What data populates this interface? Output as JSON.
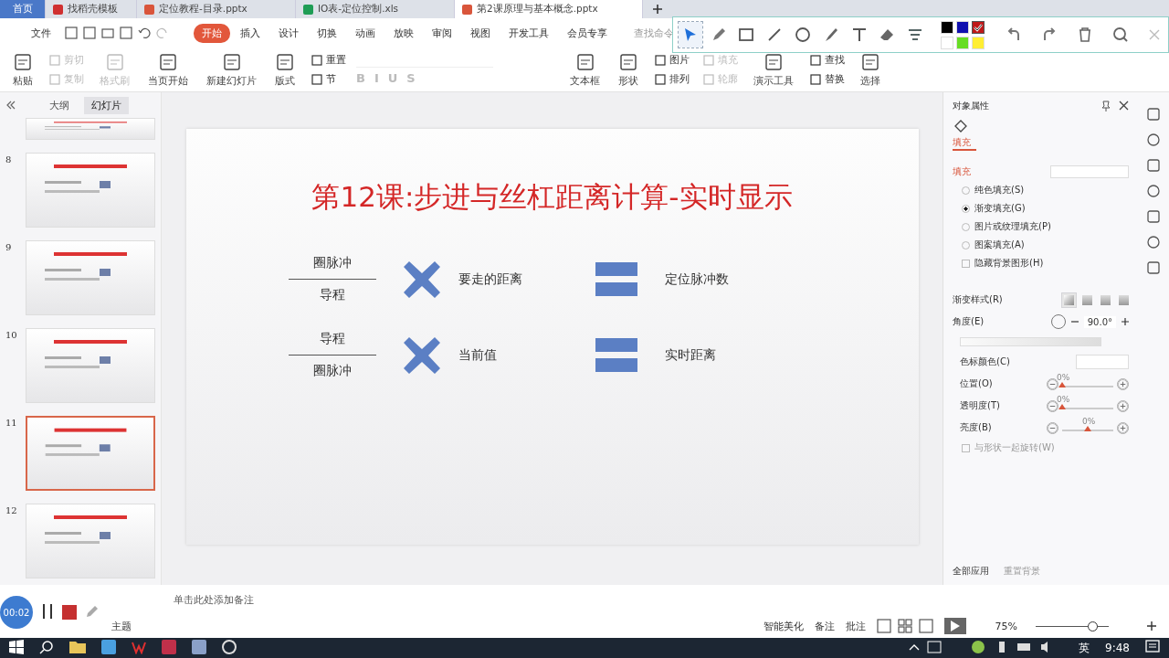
{
  "tabs": [
    {
      "label": "首页",
      "kind": "home",
      "selected": false
    },
    {
      "label": "找稻壳模板",
      "kind": "wps",
      "selected": false
    },
    {
      "label": "定位教程-目录.pptx",
      "kind": "ppt",
      "selected": false
    },
    {
      "label": "IO表-定位控制.xls",
      "kind": "xls",
      "selected": false
    },
    {
      "label": "第2课原理与基本概念.pptx",
      "kind": "ppt",
      "selected": true
    }
  ],
  "menu": {
    "file": "文件",
    "items": [
      {
        "label": "开始",
        "selected": true
      },
      {
        "label": "插入",
        "selected": false
      },
      {
        "label": "设计",
        "selected": false
      },
      {
        "label": "切换",
        "selected": false
      },
      {
        "label": "动画",
        "selected": false
      },
      {
        "label": "放映",
        "selected": false
      },
      {
        "label": "审阅",
        "selected": false
      },
      {
        "label": "视图",
        "selected": false
      },
      {
        "label": "开发工具",
        "selected": false
      },
      {
        "label": "会员专享",
        "selected": false
      }
    ],
    "search": "查找命令"
  },
  "ribbon": [
    {
      "kind": "big",
      "label": "粘贴",
      "disabled": false
    },
    {
      "kind": "pair",
      "items": [
        {
          "label": "剪切",
          "disabled": true
        },
        {
          "label": "复制",
          "disabled": true
        }
      ]
    },
    {
      "kind": "big",
      "label": "格式刷",
      "disabled": true
    },
    {
      "kind": "big",
      "label": "当页开始",
      "disabled": false
    },
    {
      "kind": "big",
      "label": "新建幻灯片",
      "disabled": false
    },
    {
      "kind": "big",
      "label": "版式",
      "disabled": false
    },
    {
      "kind": "pair",
      "items": [
        {
          "label": "重置",
          "disabled": false
        },
        {
          "label": "节",
          "disabled": false
        }
      ]
    },
    {
      "kind": "format",
      "buttons": [
        "B",
        "I",
        "U",
        "S"
      ]
    },
    {
      "kind": "big",
      "label": "文本框",
      "disabled": false
    },
    {
      "kind": "big",
      "label": "形状",
      "disabled": false
    },
    {
      "kind": "pair",
      "items": [
        {
          "label": "图片",
          "disabled": false
        },
        {
          "label": "排列",
          "disabled": false
        }
      ]
    },
    {
      "kind": "pair",
      "items": [
        {
          "label": "填充",
          "disabled": true
        },
        {
          "label": "轮廓",
          "disabled": true
        }
      ]
    },
    {
      "kind": "big",
      "label": "演示工具",
      "disabled": false
    },
    {
      "kind": "pair",
      "items": [
        {
          "label": "查找",
          "disabled": false
        },
        {
          "label": "替换",
          "disabled": false
        }
      ]
    },
    {
      "kind": "big",
      "label": "选择",
      "disabled": false
    }
  ],
  "annotation_toolbar": {
    "tools": [
      {
        "selected": true
      },
      {
        "selected": false
      },
      {
        "selected": false
      },
      {
        "selected": false
      },
      {
        "selected": false
      },
      {
        "selected": false
      },
      {
        "selected": false
      },
      {
        "selected": false
      },
      {
        "selected": false
      }
    ],
    "colors": [
      {
        "color": "#000000",
        "selected": false
      },
      {
        "color": "#1010b0",
        "selected": false
      },
      {
        "color": "#c01818",
        "selected": true
      },
      {
        "color": "#ffffff",
        "selected": false
      },
      {
        "color": "#66dd22",
        "selected": false
      },
      {
        "color": "#ffee33",
        "selected": false
      }
    ]
  },
  "slide_panel": {
    "tabs": [
      {
        "label": "大纲",
        "selected": false
      },
      {
        "label": "幻灯片",
        "selected": true
      }
    ],
    "slides": [
      {
        "selected": false
      },
      {
        "number": "8",
        "selected": false
      },
      {
        "number": "9",
        "selected": false
      },
      {
        "number": "10",
        "selected": false
      },
      {
        "number": "11",
        "selected": true
      },
      {
        "number": "12",
        "selected": false
      }
    ]
  },
  "slide": {
    "title": "第12课:步进与丝杠距离计算-实时显示",
    "rows": [
      {
        "numerator": "圈脉冲",
        "denominator": "导程",
        "operand": "要走的距离",
        "result": "定位脉冲数"
      },
      {
        "numerator": "导程",
        "denominator": "圈脉冲",
        "operand": "当前值",
        "result": "实时距离"
      }
    ]
  },
  "notes": "单击此处添加备注",
  "properties": {
    "title": "对象属性",
    "tab": {
      "label": "填充",
      "selected": true
    },
    "section": "填充",
    "options": [
      {
        "kind": "radio",
        "label": "纯色填充(S)",
        "selected": false
      },
      {
        "kind": "radio",
        "label": "渐变填充(G)",
        "selected": true
      },
      {
        "kind": "radio",
        "label": "图片或纹理填充(P)",
        "selected": false
      },
      {
        "kind": "radio",
        "label": "图案填充(A)",
        "selected": false
      },
      {
        "kind": "checkbox",
        "label": "隐藏背景图形(H)",
        "selected": false
      }
    ],
    "gradient_style": {
      "label": "渐变样式(R)",
      "styles": [
        {
          "selected": true
        },
        {
          "selected": false
        },
        {
          "selected": false
        },
        {
          "selected": false
        }
      ]
    },
    "angle": {
      "label": "角度(E)",
      "value": "90.0°"
    },
    "stop_color": "色标颜色(C)",
    "sliders": [
      {
        "label": "位置(O)",
        "reading": "0%",
        "level": 0
      },
      {
        "label": "透明度(T)",
        "reading": "0%",
        "level": 0
      },
      {
        "label": "亮度(B)",
        "reading": "0%",
        "level": 0.5
      }
    ],
    "rotate": {
      "label": "与形状一起旋转(W)",
      "checked": false
    },
    "apply_all": "全部应用",
    "reset": "重置背景"
  },
  "recorder": {
    "time": "00:02"
  },
  "theme": "主题",
  "status": {
    "beautify": "智能美化",
    "notes": "备注",
    "comments": "批注",
    "zoom": "75%",
    "zoom_slider": {
      "level": 0.78
    }
  },
  "taskbar": {
    "ime": "英",
    "time": "9:48"
  }
}
